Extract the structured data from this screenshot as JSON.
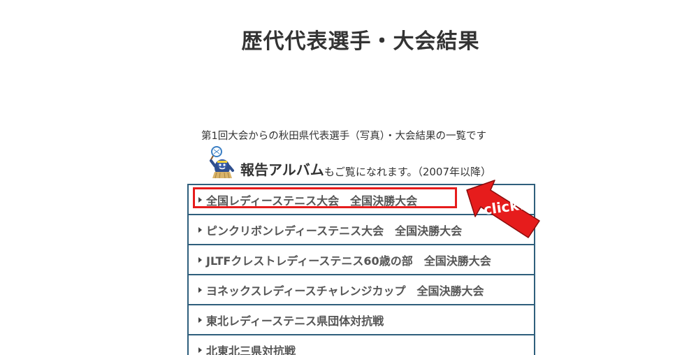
{
  "page": {
    "title": "歴代代表選手・大会結果"
  },
  "intro": {
    "text": "第1回大会からの秋田県代表選手（写真）・大会結果の一覧です"
  },
  "album": {
    "link_label": "報告アルバム",
    "suffix": "もご覧になれます。（2007年以降）",
    "mascot_icon": "tennis-mascot-icon"
  },
  "list": {
    "items": [
      {
        "label": "全国レディーステニス大会　全国決勝大会"
      },
      {
        "label": "ピンクリボンレディーステニス大会　全国決勝大会"
      },
      {
        "label": "JLTFクレストレディーステニス60歳の部　全国決勝大会"
      },
      {
        "label": "ヨネックスレディースチャレンジカップ　全国決勝大会"
      },
      {
        "label": "東北レディーステニス県団体対抗戦"
      },
      {
        "label": "北東北三県対抗戦"
      }
    ]
  },
  "annotation": {
    "click_label": "click!",
    "highlight_color": "#e61c1c",
    "arrow_color": "#e61c1c"
  },
  "colors": {
    "border": "#2f5f7c",
    "text": "#333333"
  }
}
